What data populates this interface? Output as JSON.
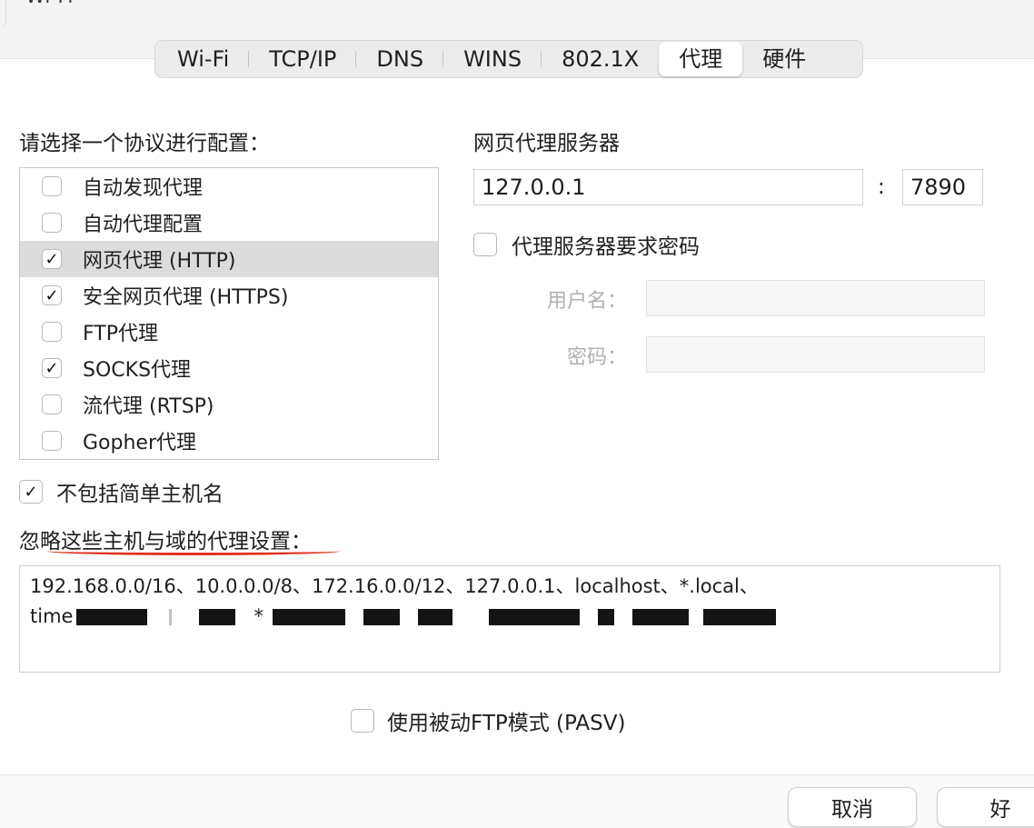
{
  "window": {
    "title": "Wi-Fi"
  },
  "tabs": [
    {
      "label": "Wi-Fi"
    },
    {
      "label": "TCP/IP"
    },
    {
      "label": "DNS"
    },
    {
      "label": "WINS"
    },
    {
      "label": "802.1X"
    },
    {
      "label": "代理",
      "active": true
    },
    {
      "label": "硬件"
    }
  ],
  "protocols": {
    "heading": "请选择一个协议进行配置：",
    "items": [
      {
        "label": "自动发现代理",
        "checked": false
      },
      {
        "label": "自动代理配置",
        "checked": false
      },
      {
        "label": "网页代理 (HTTP)",
        "checked": true,
        "selected": true
      },
      {
        "label": "安全网页代理 (HTTPS)",
        "checked": true
      },
      {
        "label": "FTP代理",
        "checked": false
      },
      {
        "label": "SOCKS代理",
        "checked": true
      },
      {
        "label": "流代理 (RTSP)",
        "checked": false
      },
      {
        "label": "Gopher代理",
        "checked": false
      }
    ]
  },
  "proxy_server": {
    "heading": "网页代理服务器",
    "host": "127.0.0.1",
    "colon": ":",
    "port": "7890",
    "require_password_label": "代理服务器要求密码",
    "require_password": false,
    "username_label": "用户名：",
    "username": "",
    "password_label": "密码：",
    "password": ""
  },
  "exclude_simple_hostnames": {
    "label": "不包括简单主机名",
    "checked": true
  },
  "bypass": {
    "heading": "忽略这些主机与域的代理设置：",
    "line1": "192.168.0.0/16、10.0.0.0/8、172.16.0.0/12、127.0.0.1、localhost、*.local、",
    "line2_prefix": "time",
    "line2_star": "*"
  },
  "passive_ftp": {
    "label": "使用被动FTP模式 (PASV)",
    "checked": false
  },
  "buttons": {
    "cancel": "取消",
    "ok": "好"
  },
  "colors": {
    "annotation_underline": "#e0321d",
    "selection": "#dcdcdc"
  }
}
